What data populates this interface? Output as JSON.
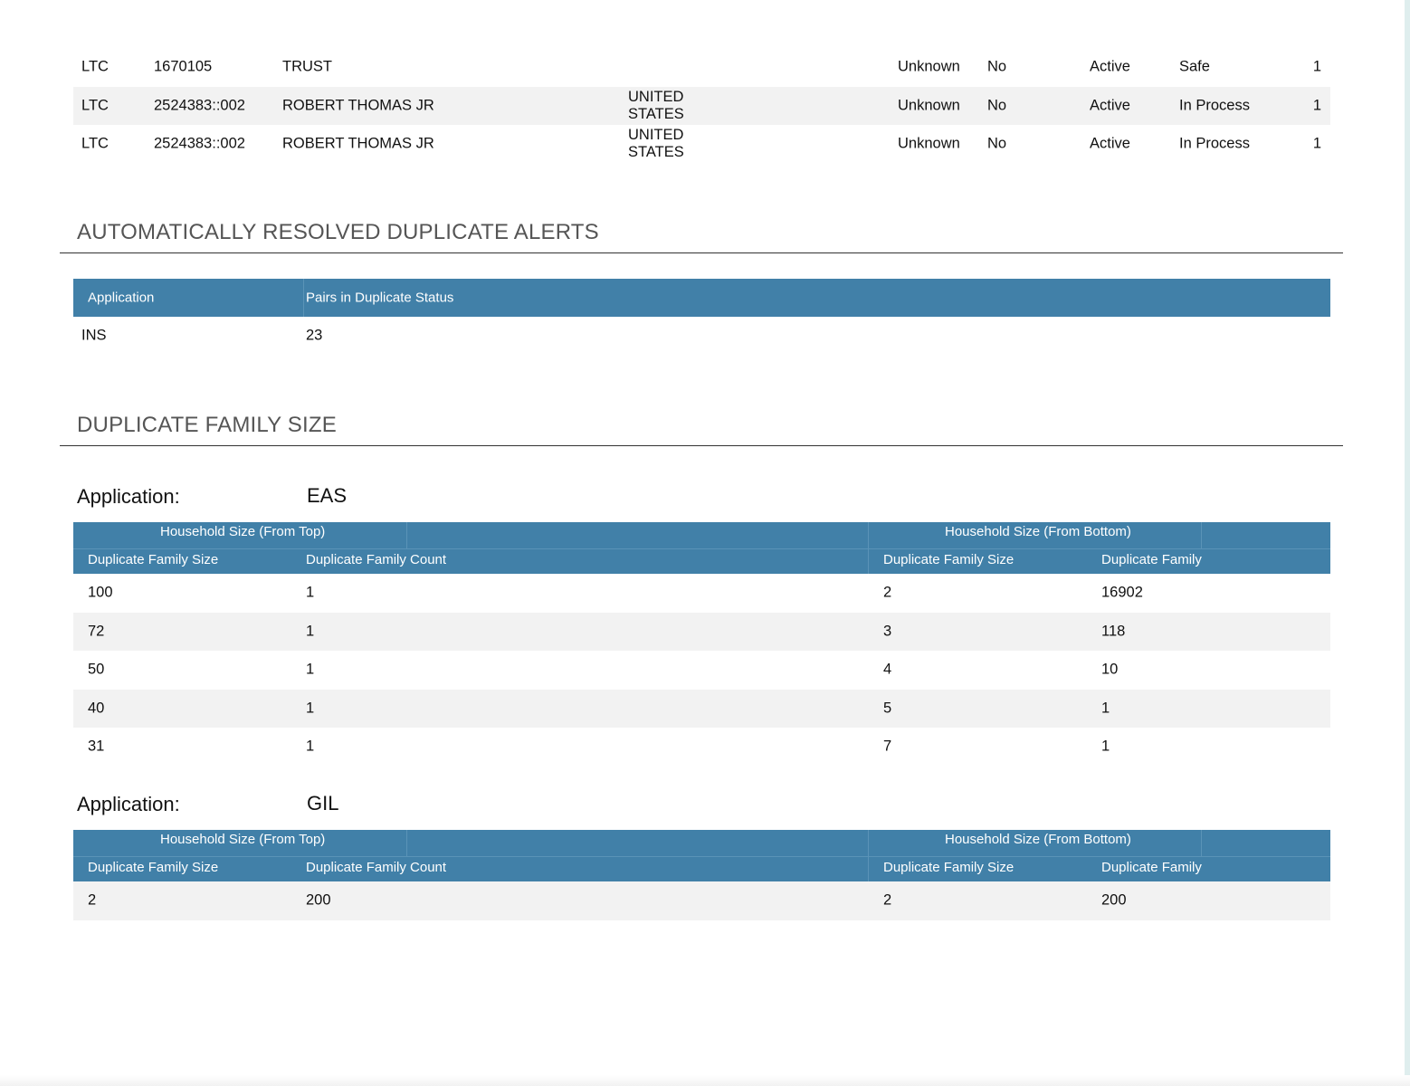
{
  "alert_rows": [
    {
      "application": "LTC",
      "id": "1670105",
      "name": "TRUST",
      "country": "",
      "risk": "Unknown",
      "flag": "No",
      "state": "Active",
      "status": "Safe",
      "count": "1"
    },
    {
      "application": "LTC",
      "id": "2524383::002",
      "name": "ROBERT THOMAS JR",
      "country": "UNITED STATES",
      "risk": "Unknown",
      "flag": "No",
      "state": "Active",
      "status": "In Process",
      "count": "1"
    },
    {
      "application": "LTC",
      "id": "2524383::002",
      "name": "ROBERT THOMAS JR",
      "country": "UNITED STATES",
      "risk": "Unknown",
      "flag": "No",
      "state": "Active",
      "status": "In Process",
      "count": "1"
    }
  ],
  "auto_resolved": {
    "title": "AUTOMATICALLY RESOLVED DUPLICATE ALERTS",
    "headers": [
      "Application",
      "Pairs in Duplicate Status"
    ],
    "rows": [
      {
        "application": "INS",
        "pairs": "23"
      }
    ]
  },
  "family_size": {
    "title": "DUPLICATE FAMILY SIZE",
    "application_label": "Application:",
    "group_top": "Household Size (From Top)",
    "group_bottom": "Household Size (From Bottom)",
    "col_size": "Duplicate Family Size",
    "col_count": "Duplicate Family Count",
    "col_count_truncated": "Duplicate Family",
    "tables": [
      {
        "application": "EAS",
        "rows": [
          {
            "top_size": "100",
            "top_count": "1",
            "bottom_size": "2",
            "bottom_count": "16902"
          },
          {
            "top_size": "72",
            "top_count": "1",
            "bottom_size": "3",
            "bottom_count": "118"
          },
          {
            "top_size": "50",
            "top_count": "1",
            "bottom_size": "4",
            "bottom_count": "10"
          },
          {
            "top_size": "40",
            "top_count": "1",
            "bottom_size": "5",
            "bottom_count": "1"
          },
          {
            "top_size": "31",
            "top_count": "1",
            "bottom_size": "7",
            "bottom_count": "1"
          }
        ]
      },
      {
        "application": "GIL",
        "rows": [
          {
            "top_size": "2",
            "top_count": "200",
            "bottom_size": "2",
            "bottom_count": "200"
          }
        ]
      }
    ]
  },
  "colors": {
    "header_blue": "#4180a8",
    "row_alt": "#f2f2f2"
  }
}
